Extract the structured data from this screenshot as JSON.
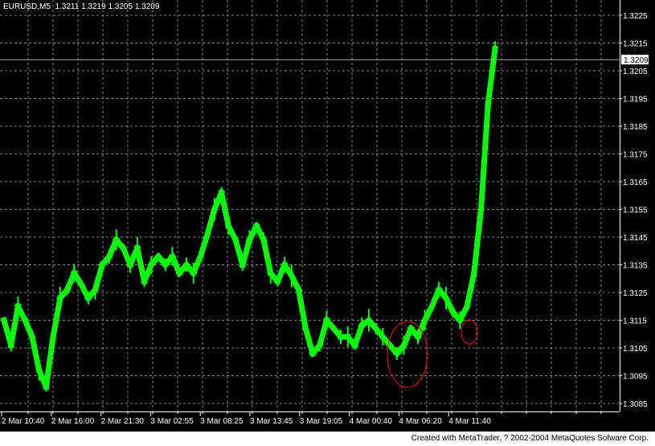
{
  "chart_data": {
    "type": "line",
    "title": "EURUSD,M5",
    "ohlc": {
      "open": "1.3211",
      "high": "1.3219",
      "low": "1.3205",
      "close": "1.3209"
    },
    "current_price": 1.3209,
    "current_price_label": "1.3209",
    "ylim": [
      1.308,
      1.323
    ],
    "y_ticks": [
      "1.3225",
      "1.3215",
      "1.3205",
      "1.3195",
      "1.3185",
      "1.3175",
      "1.3165",
      "1.3155",
      "1.3145",
      "1.3135",
      "1.3125",
      "1.3115",
      "1.3105",
      "1.3095",
      "1.3085"
    ],
    "x_ticks": [
      "2 Mar 10:40",
      "2 Mar 16:00",
      "2 Mar 21:30",
      "3 Mar 02:55",
      "3 Mar 08:25",
      "3 Mar 13:45",
      "3 Mar 19:05",
      "4 Mar 00:40",
      "4 Mar 06:20",
      "4 Mar 11:40"
    ],
    "grid": true,
    "series_color": "#00ff00",
    "annotation_color": "#ff0000",
    "values": [
      1.3115,
      1.3106,
      1.312,
      1.3115,
      1.3109,
      1.3097,
      1.3091,
      1.3109,
      1.3123,
      1.3126,
      1.3132,
      1.3128,
      1.3123,
      1.3126,
      1.3135,
      1.3138,
      1.3144,
      1.3141,
      1.3135,
      1.3141,
      1.3129,
      1.3135,
      1.3138,
      1.3135,
      1.3138,
      1.3132,
      1.3135,
      1.3132,
      1.3138,
      1.3146,
      1.3155,
      1.3161,
      1.3149,
      1.3144,
      1.3135,
      1.3144,
      1.3149,
      1.3144,
      1.3132,
      1.3129,
      1.3135,
      1.3131,
      1.3126,
      1.3112,
      1.3103,
      1.3106,
      1.3115,
      1.3112,
      1.3109,
      1.3109,
      1.3106,
      1.3113,
      1.3115,
      1.3112,
      1.3109,
      1.3106,
      1.3103,
      1.3106,
      1.3112,
      1.3109,
      1.3115,
      1.312,
      1.3126,
      1.3123,
      1.3118,
      1.3115,
      1.312,
      1.3132,
      1.3155,
      1.3193,
      1.3213
    ]
  },
  "footer": "Created with MetaTrader, ? 2002-2004 MetaQuotes Sofware Corp."
}
